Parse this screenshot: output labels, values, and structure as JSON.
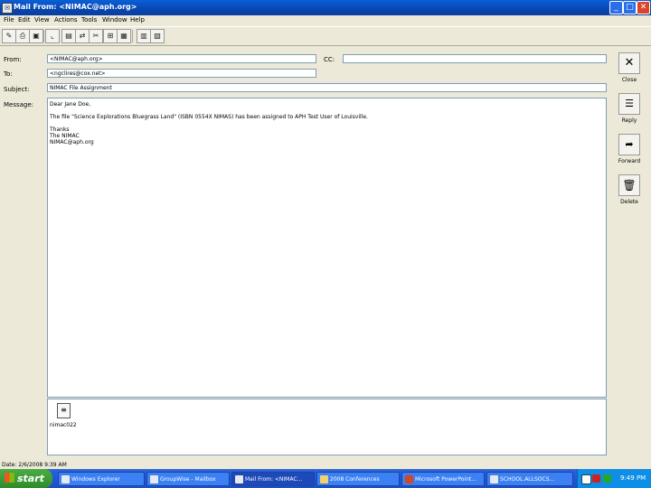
{
  "window": {
    "title": "Mail From: <NIMAC@aph.org>"
  },
  "menu": [
    "File",
    "Edit",
    "View",
    "Actions",
    "Tools",
    "Window",
    "Help"
  ],
  "form": {
    "from_label": "From:",
    "from_value": "<NIMAC@aph.org>",
    "cc_label": "CC:",
    "cc_value": "",
    "to_label": "To:",
    "to_value": "<ngclires@cox.net>",
    "subject_label": "Subject:",
    "subject_value": "NIMAC File Assignment",
    "message_label": "Message:"
  },
  "message": {
    "greeting": "Dear Jane Doe,",
    "body": "The file \"Science Explorations Bluegrass Land\" (ISBN 0554X NIMAS) has been assigned to APH Test User of Louisville.",
    "thanks": "Thanks",
    "sign1": "The NIMAC",
    "sign2": "NIMAC@aph.org"
  },
  "attachment": {
    "name": "nimac022"
  },
  "side_buttons": {
    "close": "Close",
    "reply": "Reply",
    "forward": "Forward",
    "delete": "Delete"
  },
  "status": {
    "date": "Date: 2/6/2008 9:39 AM"
  },
  "taskbar": {
    "start": "start",
    "tasks": [
      "Windows Explorer",
      "GroupWise - Mailbox",
      "Mail From: <NIMAC...",
      "2008 Conferences",
      "Microsoft PowerPoint...",
      "SCHOOL.ALLSOCS..."
    ],
    "clock": "9:49 PM"
  },
  "colors": {
    "titlebar": "#0846b0",
    "start_button": "#3a9a34",
    "taskbar": "#245edb",
    "tray": "#0f8ee8"
  }
}
